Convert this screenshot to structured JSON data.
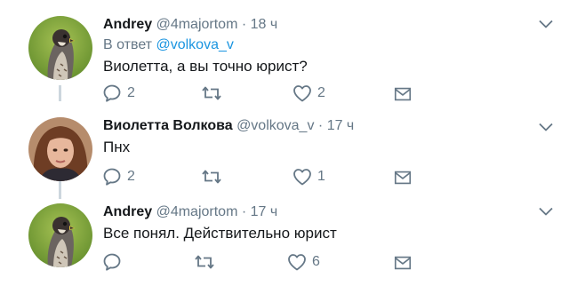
{
  "tweets": [
    {
      "name": "Andrey",
      "handle": "@4majortom",
      "separator": "·",
      "time": "18 ч",
      "reply_prefix": "В ответ",
      "reply_mention": "@volkova_v",
      "text": "Виолетта, а вы точно юрист?",
      "reply_count": "2",
      "retweet_count": "",
      "like_count": "2",
      "avatar": "falcon-avatar"
    },
    {
      "name": "Виолетта Волкова",
      "handle": "@volkova_v",
      "separator": "·",
      "time": "17 ч",
      "text": "Пнх",
      "reply_count": "2",
      "retweet_count": "",
      "like_count": "1",
      "avatar": "woman-avatar"
    },
    {
      "name": "Andrey",
      "handle": "@4majortom",
      "separator": "·",
      "time": "17 ч",
      "text": "Все понял. Действительно юрист",
      "reply_count": "",
      "retweet_count": "",
      "like_count": "6",
      "avatar": "falcon-avatar"
    }
  ],
  "icons": {
    "reply": "reply-icon",
    "retweet": "retweet-icon",
    "like": "heart-icon",
    "message": "envelope-icon",
    "more": "chevron-down-icon"
  },
  "colors": {
    "text_primary": "#14171a",
    "text_secondary": "#657786",
    "link": "#1b95e0",
    "thread_line": "#ccd6dd"
  }
}
